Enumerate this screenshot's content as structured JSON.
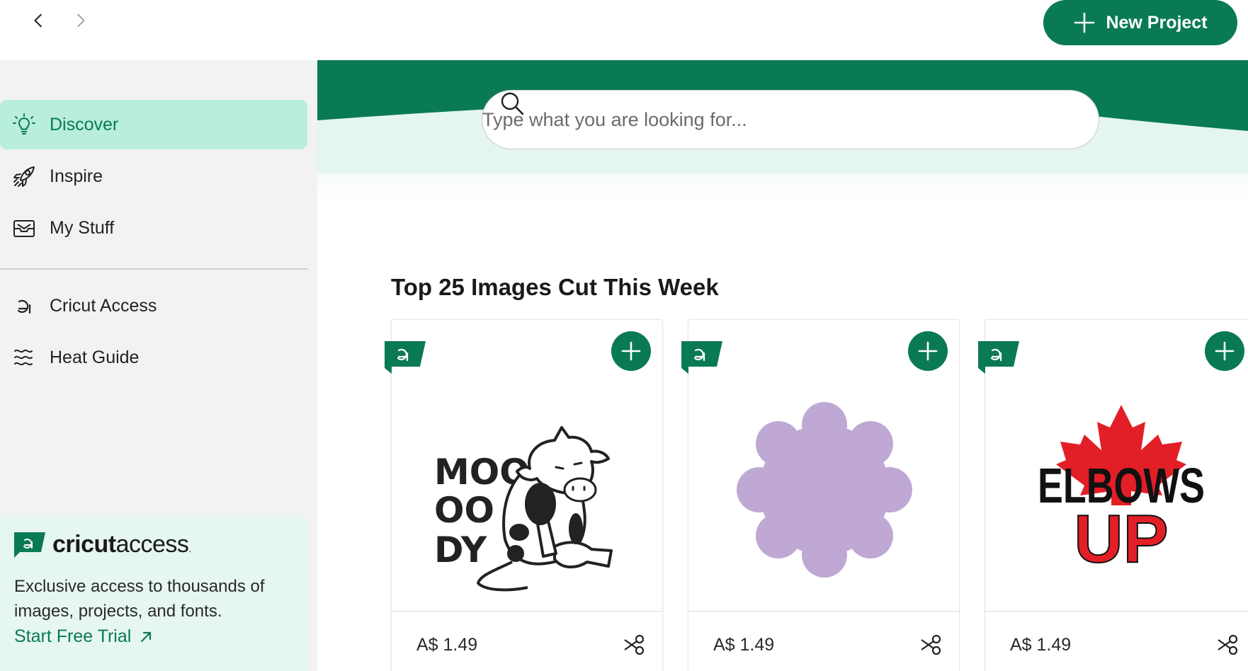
{
  "header": {
    "back_icon": "chevron-left-icon",
    "forward_icon": "chevron-right-icon",
    "new_project_label": "New Project"
  },
  "sidebar": {
    "items": [
      {
        "label": "Discover",
        "icon": "lightbulb-icon",
        "active": true
      },
      {
        "label": "Inspire",
        "icon": "rocket-icon",
        "active": false
      },
      {
        "label": "My Stuff",
        "icon": "inbox-icon",
        "active": false
      },
      {
        "label": "Cricut Access",
        "icon": "cricut-access-icon",
        "active": false
      },
      {
        "label": "Heat Guide",
        "icon": "heat-waves-icon",
        "active": false
      }
    ],
    "promo": {
      "brand_bold": "cricut",
      "brand_light": "access",
      "trademark": ".",
      "text": "Exclusive access to thousands of images, projects, and fonts.",
      "link_label": "Start Free Trial"
    }
  },
  "search": {
    "placeholder": "Type what you are looking for..."
  },
  "section": {
    "title": "Top 25 Images Cut This Week"
  },
  "cards": [
    {
      "price": "A$ 1.49",
      "image": "cow-moo-image",
      "image_text": [
        "MOO",
        "OO",
        "DY"
      ]
    },
    {
      "price": "A$ 1.49",
      "image": "purple-scallop-circle-image"
    },
    {
      "price": "A$ 1.49",
      "image": "elbows-up-maple-leaf-image",
      "image_text": [
        "ELBOWS",
        "UP"
      ]
    }
  ],
  "colors": {
    "brand_green": "#0a7a55",
    "active_bg": "#b9eddc",
    "promo_bg": "#e6f6f0",
    "hero_light": "#e4f6ef",
    "scallop_purple": "#bfa8d4",
    "maple_red": "#e21f26"
  }
}
